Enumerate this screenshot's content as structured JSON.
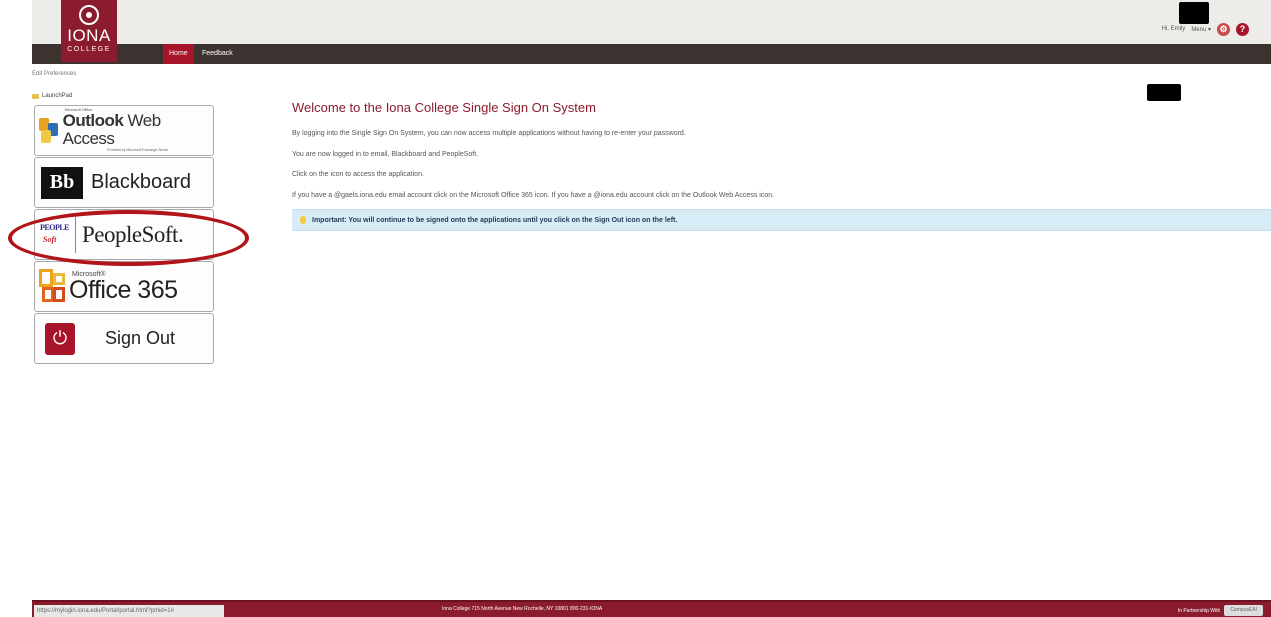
{
  "header": {
    "logo_name": "IONA",
    "logo_sub": "COLLEGE",
    "user_greeting": "Hi, Emily",
    "menu_label": "Menu ▾"
  },
  "nav": {
    "home": "Home",
    "feedback": "Feedback"
  },
  "sidebar": {
    "edit_preferences": "Edit Preferences",
    "launchpad": "LaunchPad",
    "owa": {
      "small": "Microsoft Office",
      "main_bold": "Outlook",
      "main_light": " Web Access",
      "tiny": "Provided by Microsoft Exchange Server"
    },
    "blackboard": {
      "icon": "Bb",
      "label": "Blackboard"
    },
    "peoplesoft": {
      "icon_top": "PEOPLE",
      "icon_bottom": "Soft",
      "label": "PeopleSoft."
    },
    "office365": {
      "small": "Microsoft®",
      "label": "Office 365"
    },
    "signout": {
      "icon": "⏻",
      "label": "Sign Out"
    }
  },
  "main": {
    "title": "Welcome to the Iona College Single Sign On System",
    "p1": "By logging into the Single Sign On System, you can now access multiple applications without having to re-enter your password.",
    "p2": "You are now logged in to email, Blackboard and PeopleSoft.",
    "p3": "Click on the icon to access the application.",
    "p4": "If you have a @gaels.iona.edu email account click on the Microsoft Office 365 icon. If you have a @iona.edu account click on the Outlook Web Access icon.",
    "notice": "Important: You will continue to be signed onto the applications until you click on the Sign Out icon on the left."
  },
  "footer": {
    "url": "https://mylogin.iona.edu/Portal/portal.html?pmid=1#",
    "center": "Iona College 715 North Avenue New Rochelle, NY 10801 800-231-IONA",
    "partnership": "In Partnership With",
    "partner_name": "CampusEAI"
  },
  "colors": {
    "brand": "#8b1c2e",
    "nav_bg": "#3c3330",
    "notice_bg": "#d8ecf8",
    "highlight": "#b11419"
  }
}
